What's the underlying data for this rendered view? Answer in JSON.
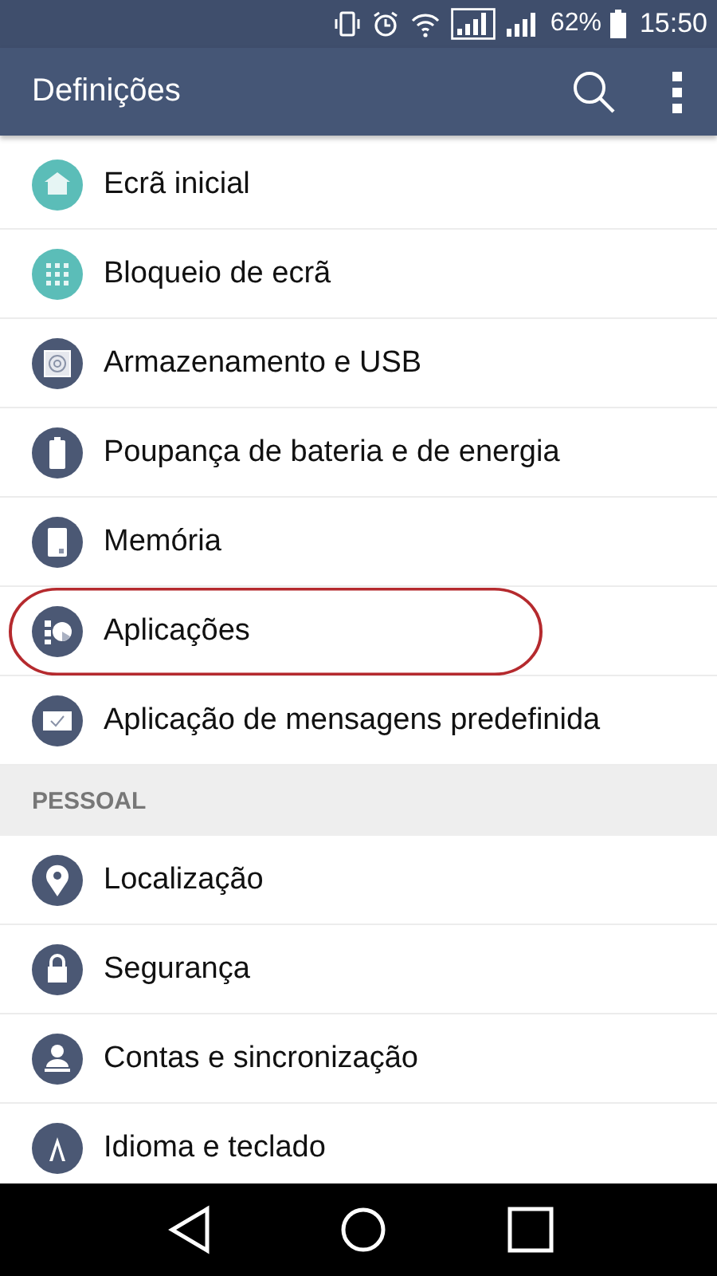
{
  "status_bar": {
    "battery_text": "62%",
    "time": "15:50"
  },
  "toolbar": {
    "title": "Definições"
  },
  "sections": [
    {
      "items": [
        {
          "label": "Ecrã inicial",
          "kind": "home",
          "color": "#5bbdb8",
          "circled": false
        },
        {
          "label": "Bloqueio de ecrã",
          "kind": "grid",
          "color": "#5bbdb8",
          "circled": false
        },
        {
          "label": "Armazenamento e USB",
          "kind": "storage",
          "color": "#4b5874",
          "circled": false
        },
        {
          "label": "Poupança de bateria e de energia",
          "kind": "battery",
          "color": "#4b5874",
          "circled": false
        },
        {
          "label": "Memória",
          "kind": "memory",
          "color": "#4b5874",
          "circled": false
        },
        {
          "label": "Aplicações",
          "kind": "apps",
          "color": "#4b5874",
          "circled": true
        },
        {
          "label": "Aplicação de mensagens predefinida",
          "kind": "message",
          "color": "#4b5874",
          "circled": false
        }
      ]
    },
    {
      "header": "PESSOAL",
      "items": [
        {
          "label": "Localização",
          "kind": "location",
          "color": "#4b5874",
          "circled": false
        },
        {
          "label": "Segurança",
          "kind": "lock",
          "color": "#4b5874",
          "circled": false
        },
        {
          "label": "Contas e sincronização",
          "kind": "account",
          "color": "#4b5874",
          "circled": false
        },
        {
          "label": "Idioma e teclado",
          "kind": "language",
          "color": "#4b5874",
          "circled": false
        }
      ]
    }
  ]
}
